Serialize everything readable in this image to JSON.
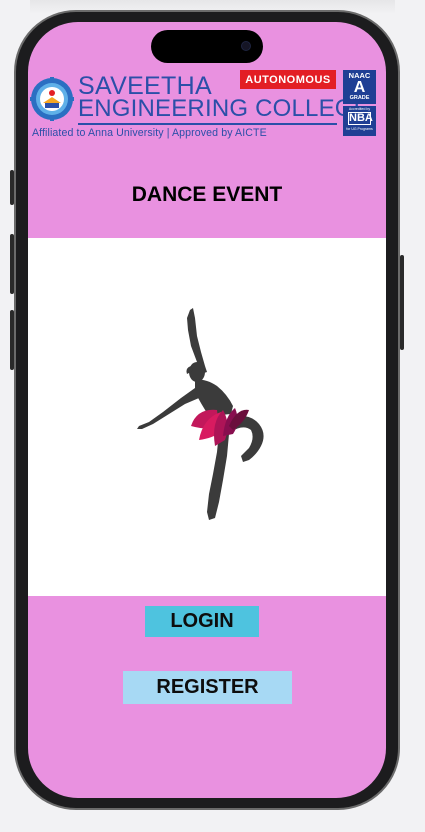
{
  "header": {
    "college_name_line1": "SAVEETHA",
    "college_name_line2": "ENGINEERING COLLEGE",
    "tagline": "Affiliated to Anna University | Approved by AICTE",
    "autonomous_badge": "AUTONOMOUS",
    "naac_badge": {
      "line1": "NAAC",
      "grade": "A",
      "line3": "GRADE"
    },
    "nba_badge": {
      "line1": "Accredited by",
      "mark": "NBA",
      "line3": "for UG Programs"
    }
  },
  "page": {
    "title": "DANCE EVENT"
  },
  "hero": {
    "image_icon": "ballerina-dancer-illustration"
  },
  "actions": {
    "login_label": "LOGIN",
    "register_label": "REGISTER"
  },
  "colors": {
    "screen_background": "#e991e0",
    "hero_background": "#ffffff",
    "brand_blue": "#2b4fa8",
    "autonomous_red": "#e31e24",
    "login_button": "#4ec3df",
    "register_button": "#a7d9f4",
    "skirt_magenta": "#c2185b"
  }
}
